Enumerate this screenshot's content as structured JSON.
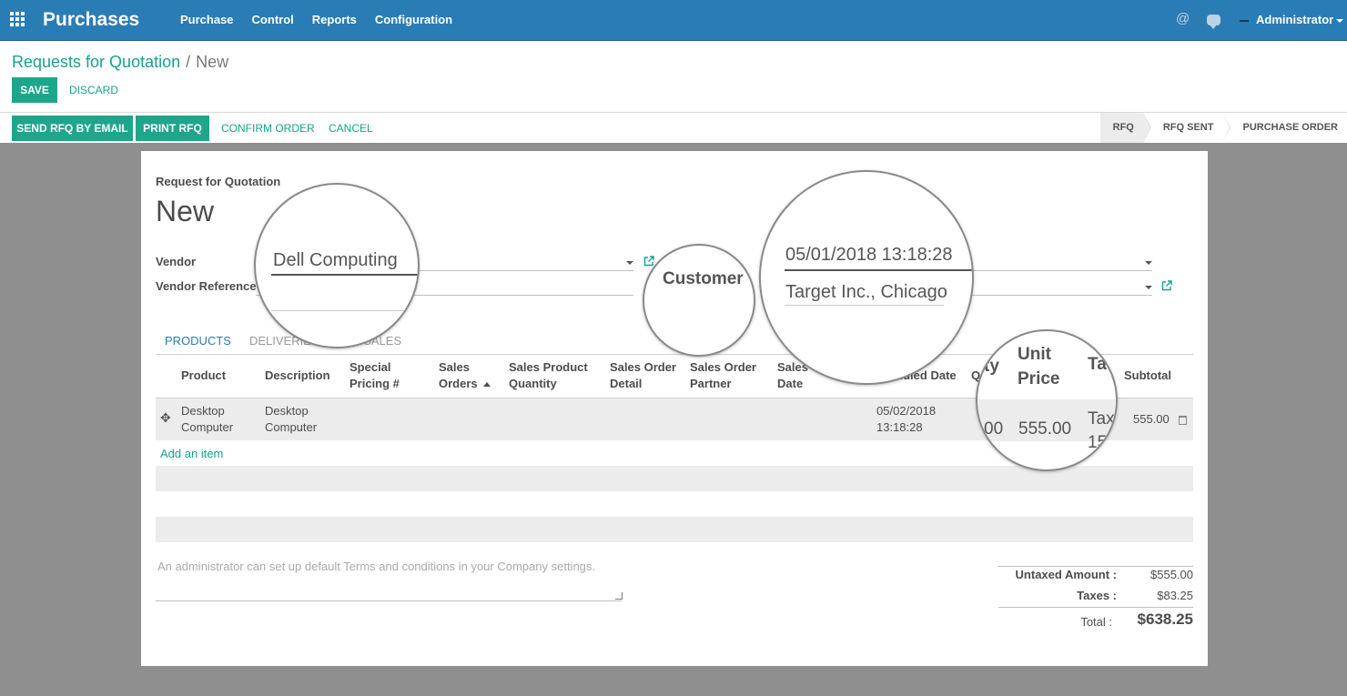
{
  "navbar": {
    "app_name": "Purchases",
    "menu": [
      "Purchase",
      "Control",
      "Reports",
      "Configuration"
    ],
    "at_symbol": "@",
    "user": "Administrator",
    "color": "#2a7cb5"
  },
  "breadcrumb": {
    "parent": "Requests for Quotation",
    "separator": "/",
    "current": "New"
  },
  "actions": {
    "save": "SAVE",
    "discard": "DISCARD",
    "send_rfq": "SEND RFQ BY EMAIL",
    "print_rfq": "PRINT RFQ",
    "confirm_order": "CONFIRM ORDER",
    "cancel": "CANCEL"
  },
  "status_steps": [
    "RFQ",
    "RFQ SENT",
    "PURCHASE ORDER"
  ],
  "form": {
    "doc_type": "Request for Quotation",
    "name": "New",
    "vendor_label": "Vendor",
    "vendor_ref_label": "Vendor Reference"
  },
  "tabs": [
    "PRODUCTS",
    "DELIVERIES",
    "S",
    "SALES"
  ],
  "table": {
    "headers": {
      "product": "Product",
      "description": "Description",
      "special_pricing_1": "Special",
      "special_pricing_2": "Pricing #",
      "sales_orders_1": "Sales",
      "sales_orders_2": "Orders",
      "sales_product_qty_1": "Sales Product",
      "sales_product_qty_2": "Quantity",
      "sales_order_detail_1": "Sales Order",
      "sales_order_detail_2": "Detail",
      "sales_order_partner_1": "Sales Order",
      "sales_order_partner_2": "Partner",
      "sales_date_1": "Sales",
      "sales_date_2": "Date",
      "scheduled_date": "heduled Date",
      "qty": "Q",
      "subtotal": "Subtotal"
    },
    "rows": [
      {
        "product_1": "Desktop",
        "product_2": "Computer",
        "description_1": "Desktop",
        "description_2": "Computer",
        "scheduled_1": "05/02/2018",
        "scheduled_2": "13:18:28",
        "subtotal": "555.00"
      }
    ],
    "add_item": "Add an item"
  },
  "notes_placeholder": "An administrator can set up default Terms and conditions in your Company settings.",
  "totals": {
    "untaxed_label": "Untaxed Amount :",
    "untaxed_value": "$555.00",
    "taxes_label": "Taxes :",
    "taxes_value": "$83.25",
    "total_label": "Total :",
    "total_value": "$638.25"
  },
  "magnifiers": {
    "vendor_value": "Dell Computing",
    "customer_label": "Customer",
    "date_value": "05/01/2018 13:18:28",
    "customer_value": "Target Inc., Chicago",
    "price_header_1": "Unit",
    "price_header_2": "Price",
    "qty_header_part": "ty",
    "tax_header_part": "Ta",
    "qty_value_part": "00",
    "price_value": "555.00",
    "tax_value_1": "Tax",
    "tax_value_2": "15"
  }
}
